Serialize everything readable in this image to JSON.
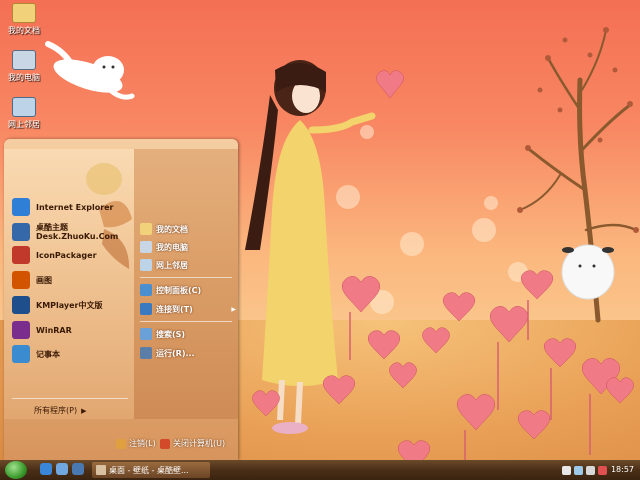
{
  "desktop": {
    "icons": [
      {
        "label": "我的文档",
        "icon": "documents-icon"
      },
      {
        "label": "我的电脑",
        "icon": "computer-icon"
      },
      {
        "label": "网上邻居",
        "icon": "network-icon"
      }
    ]
  },
  "start_menu": {
    "programs": [
      {
        "label": "Internet Explorer",
        "icon": "ie-icon",
        "color": "#2f7fd6"
      },
      {
        "label": "桌酷主题",
        "sublabel": "Desk.ZhuoKu.Com",
        "icon": "zhuoku-icon",
        "color": "#3568a8"
      },
      {
        "label": "IconPackager",
        "icon": "iconpackager-icon",
        "color": "#c0392b"
      },
      {
        "label": "画图",
        "icon": "paint-icon",
        "color": "#d35400"
      },
      {
        "label": "KMPlayer中文版",
        "icon": "kmplayer-icon",
        "color": "#1f4e8c"
      },
      {
        "label": "WinRAR",
        "icon": "winrar-icon",
        "color": "#7b2d8e"
      },
      {
        "label": "记事本",
        "icon": "notepad-icon",
        "color": "#3b8bd0"
      }
    ],
    "all_programs_label": "所有程序(P)",
    "places": [
      {
        "label": "我的文档",
        "icon": "documents-icon"
      },
      {
        "label": "我的电脑",
        "icon": "computer-icon"
      },
      {
        "label": "网上邻居",
        "icon": "network-icon"
      },
      {
        "label": "控制面板(C)",
        "icon": "control-panel-icon"
      },
      {
        "label": "连接到(T)",
        "icon": "connect-icon"
      },
      {
        "label": "搜索(S)",
        "icon": "search-icon"
      },
      {
        "label": "运行(R)...",
        "icon": "run-icon"
      }
    ],
    "logoff_label": "注销(L)",
    "shutdown_label": "关闭计算机(U)"
  },
  "taskbar": {
    "task_label": "桌面 - 壁纸 - 桌酷壁...",
    "clock": "18:57"
  }
}
